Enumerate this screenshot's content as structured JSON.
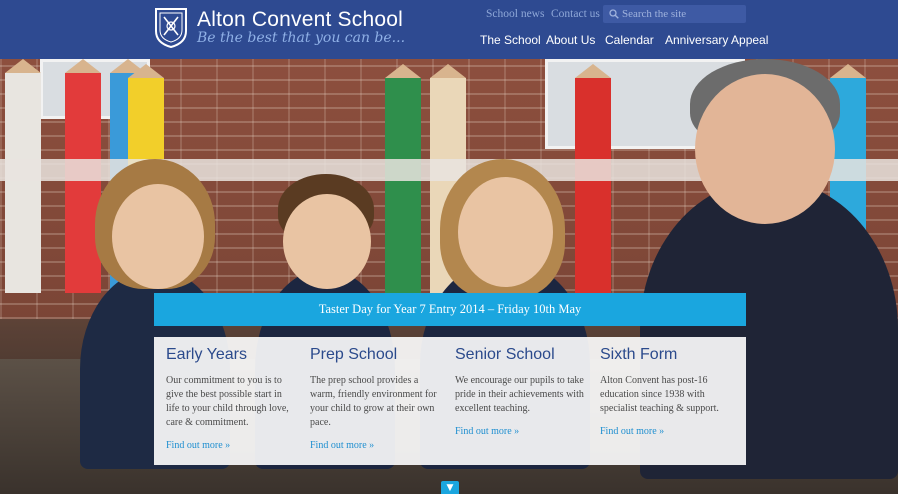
{
  "header": {
    "title": "Alton Convent School",
    "tagline": "Be the best that you can be...",
    "utility_links": [
      "School news",
      "Contact us"
    ],
    "search": {
      "placeholder": "Search the site",
      "icon": "search-icon"
    },
    "nav": [
      "The School",
      "About Us",
      "Calendar",
      "Anniversary Appeal"
    ]
  },
  "banner": {
    "text": "Taster Day for Year 7 Entry 2014 – Friday 10th May"
  },
  "sections": [
    {
      "title": "Early Years",
      "text": "Our commitment to you is to give the best possible start in life to your child through love, care & commitment.",
      "link": "Find out more »"
    },
    {
      "title": "Prep School",
      "text": "The prep school provides a warm, friendly environment for your child to grow at their own pace.",
      "link": "Find out more »"
    },
    {
      "title": "Senior School",
      "text": "We encourage our pupils to take pride in their achievements with excellent teaching.",
      "link": "Find out more »"
    },
    {
      "title": "Sixth Form",
      "text": "Alton Convent has post-16 education since 1938 with specialist teaching & support.",
      "link": "Find out more »"
    }
  ],
  "scroll_down": {
    "icon": "down-arrow-icon",
    "glyph": "▼"
  },
  "colors": {
    "header": "#2e4a91",
    "accent": "#1aa6df",
    "heading": "#2b4a8c",
    "link": "#1f8fd0"
  }
}
